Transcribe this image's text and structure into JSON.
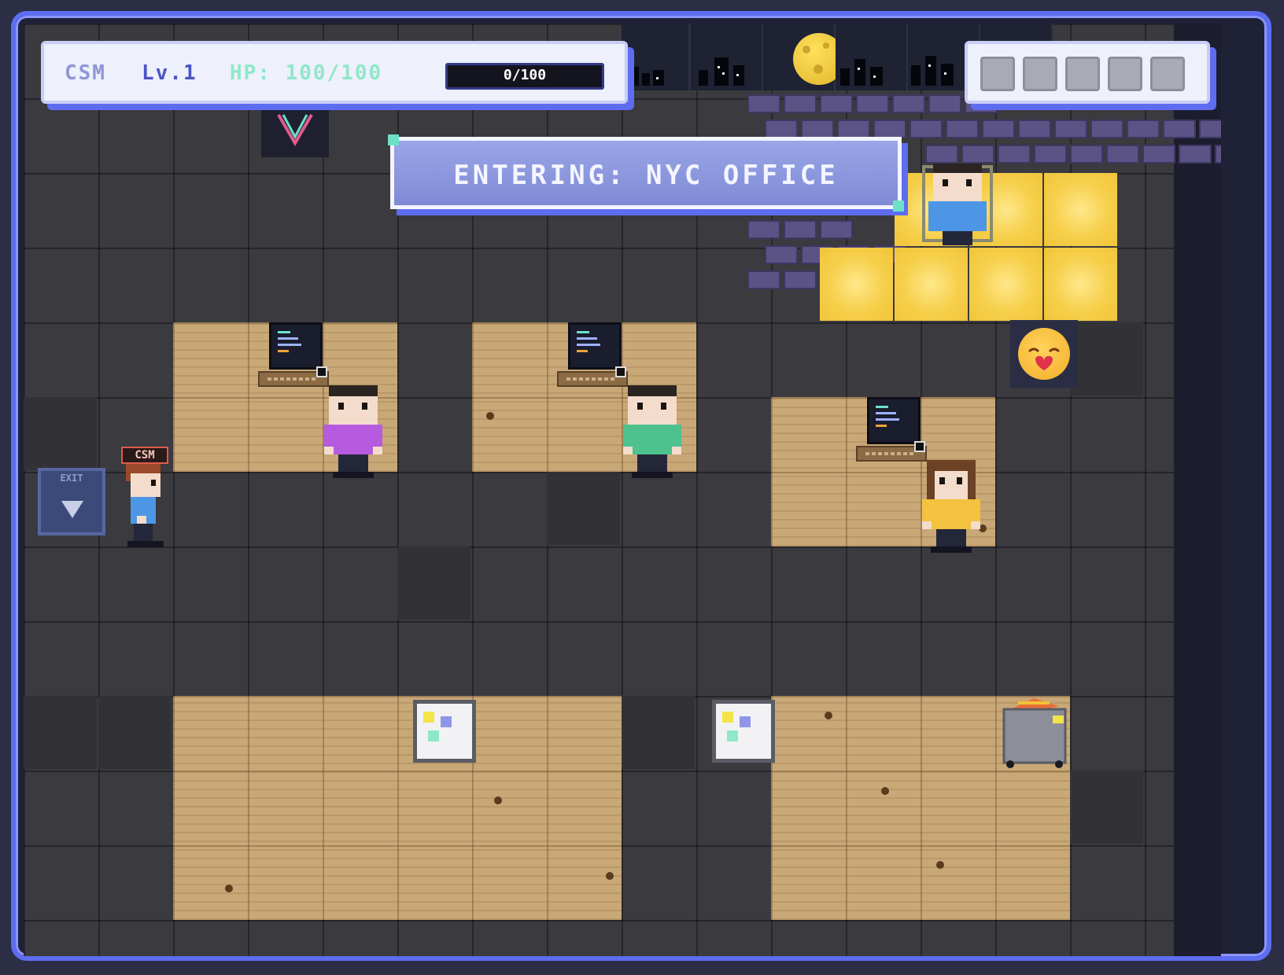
{
  "hud": {
    "player_name": "CSM",
    "level": "Lv.1",
    "hp": "HP: 100/100",
    "xp": "0/100",
    "inventory_slots": 5
  },
  "banner": {
    "text": "ENTERING: NYC OFFICE"
  },
  "exit_sign": {
    "label": "EXIT"
  },
  "player_tag": {
    "label": "CSM"
  },
  "colors": {
    "frame": "#5e6df0",
    "hud_name": "#8f96d6",
    "hud_level": "#4b55c4",
    "hud_hp": "#8fe8c8",
    "banner": "#8591db",
    "highlight": "#f6cf4a"
  },
  "npcs": [
    {
      "name": "purple-shirt-coworker",
      "shirt": "#b65ae0"
    },
    {
      "name": "green-shirt-coworker",
      "shirt": "#4dc28f"
    },
    {
      "name": "yellow-shirt-coworker",
      "shirt": "#f3c23e"
    },
    {
      "name": "blue-shirt-coworker",
      "shirt": "#4d96e6"
    }
  ]
}
